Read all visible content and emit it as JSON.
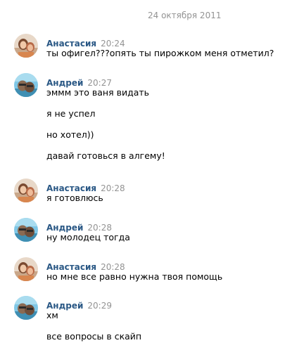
{
  "date_separator": "24 октября 2011",
  "messages": [
    {
      "author": "Анастасия",
      "time": "20:24",
      "avatar": "avatar-anastasia",
      "lines": [
        "ты офигел???опять ты пирожком меня отметил?"
      ]
    },
    {
      "author": "Андрей",
      "time": "20:27",
      "avatar": "avatar-andrey",
      "lines": [
        "эммм это ваня видать",
        "я не успел",
        "но хотел))",
        "давай готовься в алгему!"
      ]
    },
    {
      "author": "Анастасия",
      "time": "20:28",
      "avatar": "avatar-anastasia",
      "lines": [
        "я готовлюсь"
      ]
    },
    {
      "author": "Андрей",
      "time": "20:28",
      "avatar": "avatar-andrey",
      "lines": [
        "ну молодец тогда"
      ]
    },
    {
      "author": "Анастасия",
      "time": "20:28",
      "avatar": "avatar-anastasia",
      "lines": [
        "но мне все равно нужна твоя помощь"
      ]
    },
    {
      "author": "Андрей",
      "time": "20:29",
      "avatar": "avatar-andrey",
      "lines": [
        "хм",
        "все вопросы в скайп"
      ]
    }
  ],
  "colors": {
    "author_link": "#2a5885",
    "meta_gray": "#939393",
    "message_text": "#000000"
  }
}
